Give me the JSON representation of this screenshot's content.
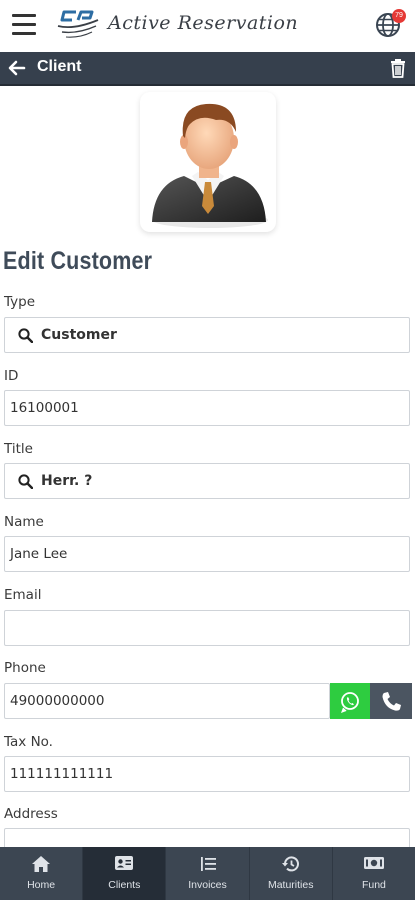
{
  "app": {
    "logo_text": "Active Reservation",
    "notification_count": "79"
  },
  "titlebar": {
    "title": "Client"
  },
  "form": {
    "heading": "Edit Customer",
    "type": {
      "label": "Type",
      "value": "Customer"
    },
    "id": {
      "label": "ID",
      "value": "16100001"
    },
    "title": {
      "label": "Title",
      "value": "Herr. ?"
    },
    "name": {
      "label": "Name",
      "value": "Jane Lee"
    },
    "email": {
      "label": "Email",
      "value": ""
    },
    "phone": {
      "label": "Phone",
      "value": "49000000000"
    },
    "tax": {
      "label": "Tax No.",
      "value": "111111111111"
    },
    "address": {
      "label": "Address",
      "value": ""
    }
  },
  "nav": {
    "home": "Home",
    "clients": "Clients",
    "invoices": "Invoices",
    "maturities": "Maturities",
    "fund": "Fund"
  },
  "colors": {
    "header_bar": "#36404d",
    "bottom_nav": "#3c4652",
    "active_tab": "#252d37",
    "whatsapp": "#2ecc40",
    "heading": "#3f4b59",
    "badge": "#e53935"
  },
  "icons": [
    "menu-icon",
    "globe-icon",
    "back-arrow-icon",
    "trash-icon",
    "search-icon",
    "whatsapp-icon",
    "phone-icon",
    "home-icon",
    "id-card-icon",
    "list-icon",
    "history-icon",
    "money-icon"
  ]
}
